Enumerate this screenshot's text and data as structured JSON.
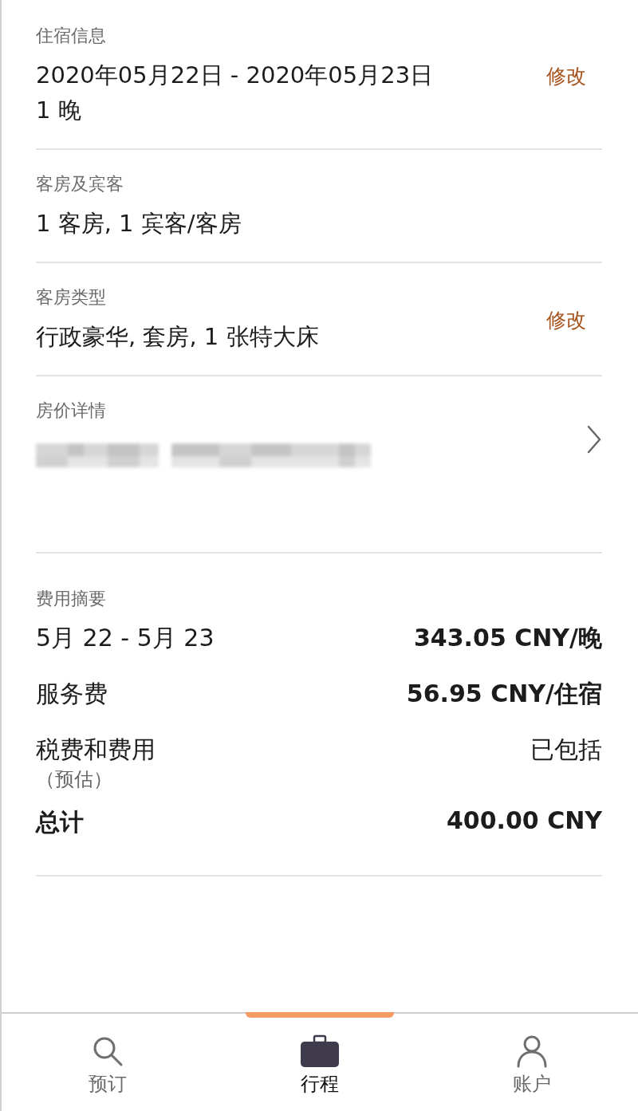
{
  "sections": [
    {
      "kind": "info",
      "label": "住宿信息",
      "lines": [
        "2020年05月22日 - 2020年05月23日",
        "1 晚"
      ],
      "action": "修改"
    },
    {
      "kind": "info",
      "label": "客房及宾客",
      "lines": [
        "1 客房, 1 宾客/客房"
      ]
    },
    {
      "kind": "info",
      "label": "客房类型",
      "lines": [
        "行政豪华, 套房, 1  张特大床"
      ],
      "action": "修改"
    },
    {
      "kind": "link",
      "label": "房价详情"
    }
  ],
  "summary": {
    "label": "费用摘要",
    "rows": [
      {
        "label": "5月 22 - 5月 23",
        "value": "343.05 CNY/晚",
        "strong": true
      },
      {
        "label": "服务费",
        "value": "56.95 CNY/住宿",
        "strong": true
      },
      {
        "label": "税费和费用",
        "note": "（预估）",
        "value": "已包括",
        "strong": false
      }
    ],
    "total": {
      "label": "总计",
      "value": "400.00 CNY"
    }
  },
  "nav": [
    {
      "label": "预订",
      "selected": false
    },
    {
      "label": "行程",
      "selected": true
    },
    {
      "label": "账户",
      "selected": false
    }
  ]
}
